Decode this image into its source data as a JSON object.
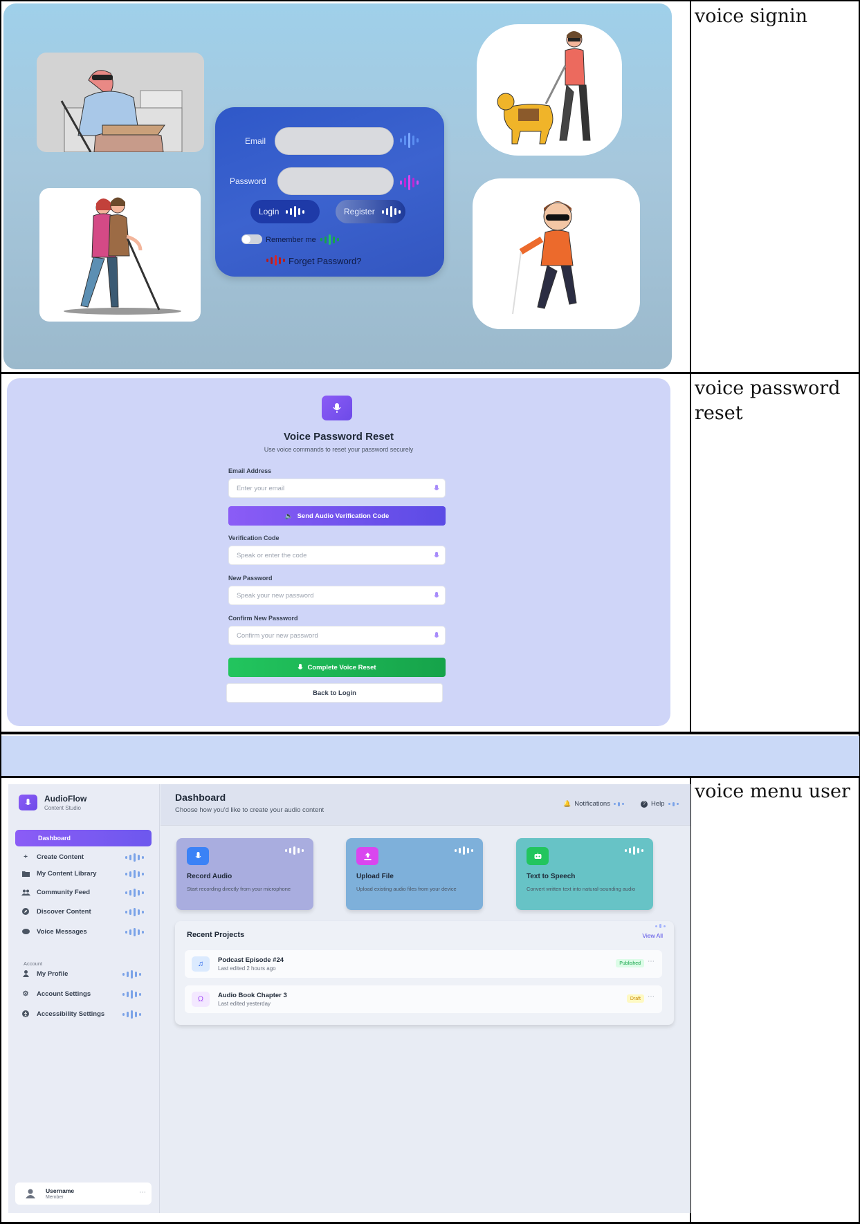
{
  "rows": [
    {
      "caption": "voice signin",
      "signin": {
        "email_label": "Email",
        "password_label": "Password",
        "login_label": "Login",
        "register_label": "Register",
        "remember_label": "Remember me",
        "forgot_label": "Forget Password?"
      }
    },
    {
      "caption": "voice password reset",
      "reset": {
        "title": "Voice Password Reset",
        "subtitle": "Use voice commands to reset your password securely",
        "email_label": "Email Address",
        "email_placeholder": "Enter your email",
        "send_button": "Send Audio Verification Code",
        "code_label": "Verification Code",
        "code_placeholder": "Speak or enter the code",
        "new_password_label": "New Password",
        "new_password_placeholder": "Speak your new password",
        "confirm_label": "Confirm New Password",
        "confirm_placeholder": "Confirm your new password",
        "complete_button": "Complete Voice Reset",
        "back_button": "Back to Login"
      }
    },
    {
      "caption": "voice menu user",
      "app": {
        "brand": "AudioFlow",
        "brand_sub": "Content Studio",
        "active_item": "Dashboard",
        "nav": [
          {
            "label": "Create Content",
            "icon": "plus-icon"
          },
          {
            "label": "My Content Library",
            "icon": "folder-icon"
          },
          {
            "label": "Community Feed",
            "icon": "users-icon"
          },
          {
            "label": "Discover Content",
            "icon": "compass-icon"
          },
          {
            "label": "Voice Messages",
            "icon": "chat-icon"
          }
        ],
        "account_label": "Account",
        "account_nav": [
          {
            "label": "My Profile",
            "icon": "user-icon"
          },
          {
            "label": "Account Settings",
            "icon": "gear-icon"
          },
          {
            "label": "Accessibility Settings",
            "icon": "accessibility-icon"
          }
        ],
        "user": {
          "name": "Username",
          "role": "Member"
        },
        "header": {
          "title": "Dashboard",
          "subtitle": "Choose how you'd like to create your audio content",
          "notifications": "Notifications",
          "help": "Help"
        },
        "cards": [
          {
            "title": "Record Audio",
            "desc": "Start recording directly from your microphone",
            "bg": "#a9addf",
            "tile": "#3b82f6",
            "icon": "mic-icon"
          },
          {
            "title": "Upload File",
            "desc": "Upload existing audio files from your device",
            "bg": "#7eb0da",
            "tile": "#d946ef",
            "icon": "upload-icon"
          },
          {
            "title": "Text to Speech",
            "desc": "Convert written text into natural-sounding audio",
            "bg": "#67c3c6",
            "tile": "#22c55e",
            "icon": "robot-icon"
          }
        ],
        "recent": {
          "title": "Recent Projects",
          "view_all": "View All",
          "items": [
            {
              "title": "Podcast Episode #24",
              "sub": "Last edited 2 hours ago",
              "badge": "Published",
              "icon": "music-icon"
            },
            {
              "title": "Audio Book Chapter 3",
              "sub": "Last edited yesterday",
              "badge": "Draft",
              "icon": "headphones-icon"
            }
          ]
        }
      }
    }
  ],
  "colors": {
    "accent": "#8b5cf6",
    "signin_card": "#3558c6",
    "success": "#22c55e"
  }
}
